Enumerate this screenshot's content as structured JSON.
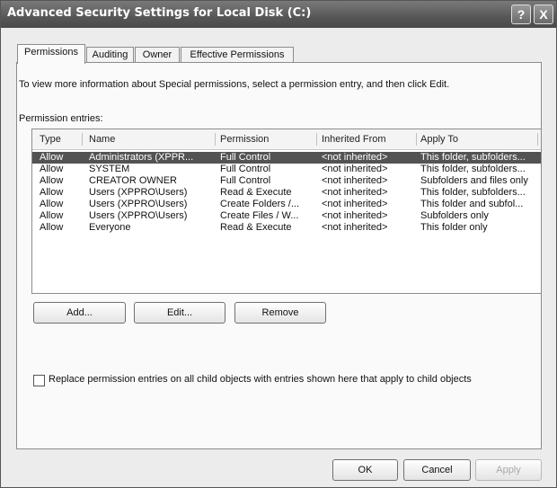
{
  "window": {
    "title": "Advanced Security Settings for Local Disk (C:)",
    "help_glyph": "?",
    "close_glyph": "X"
  },
  "tabs": [
    {
      "label": "Permissions",
      "active": true
    },
    {
      "label": "Auditing",
      "active": false
    },
    {
      "label": "Owner",
      "active": false
    },
    {
      "label": "Effective Permissions",
      "active": false
    }
  ],
  "permissions": {
    "info_text": "To view more information about Special permissions, select a permission entry, and then click Edit.",
    "entries_label": "Permission entries:",
    "columns": {
      "type": "Type",
      "name": "Name",
      "permission": "Permission",
      "inherited_from": "Inherited From",
      "apply_to": "Apply To"
    },
    "rows": [
      {
        "type": "Allow",
        "name": "Administrators (XPPR...",
        "permission": "Full Control",
        "inherited_from": "<not inherited>",
        "apply_to": "This folder, subfolders...",
        "selected": true
      },
      {
        "type": "Allow",
        "name": "SYSTEM",
        "permission": "Full Control",
        "inherited_from": "<not inherited>",
        "apply_to": "This folder, subfolders...",
        "selected": false
      },
      {
        "type": "Allow",
        "name": "CREATOR OWNER",
        "permission": "Full Control",
        "inherited_from": "<not inherited>",
        "apply_to": "Subfolders and files only",
        "selected": false
      },
      {
        "type": "Allow",
        "name": "Users (XPPRO\\Users)",
        "permission": "Read & Execute",
        "inherited_from": "<not inherited>",
        "apply_to": "This folder, subfolders...",
        "selected": false
      },
      {
        "type": "Allow",
        "name": "Users (XPPRO\\Users)",
        "permission": "Create Folders /...",
        "inherited_from": "<not inherited>",
        "apply_to": "This folder and subfol...",
        "selected": false
      },
      {
        "type": "Allow",
        "name": "Users (XPPRO\\Users)",
        "permission": "Create Files / W...",
        "inherited_from": "<not inherited>",
        "apply_to": "Subfolders only",
        "selected": false
      },
      {
        "type": "Allow",
        "name": "Everyone",
        "permission": "Read & Execute",
        "inherited_from": "<not inherited>",
        "apply_to": "This folder only",
        "selected": false
      }
    ],
    "add_label": "Add...",
    "edit_label": "Edit...",
    "remove_label": "Remove",
    "replace_checkbox_label": "Replace permission entries on all child objects with entries shown here that apply to child objects",
    "replace_checked": false
  },
  "footer": {
    "ok_label": "OK",
    "cancel_label": "Cancel",
    "apply_label": "Apply",
    "apply_enabled": false
  }
}
